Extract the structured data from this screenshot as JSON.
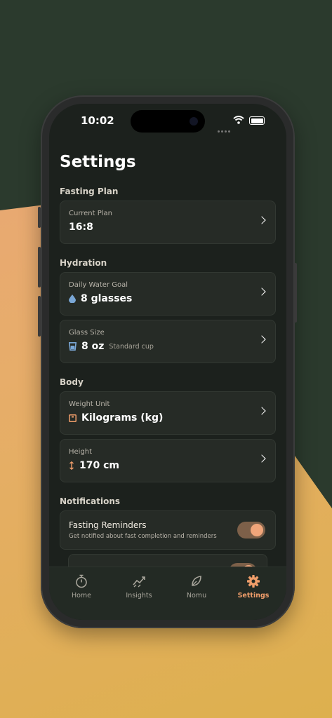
{
  "status": {
    "time": "10:02"
  },
  "page": {
    "title": "Settings"
  },
  "fasting": {
    "section": "Fasting Plan",
    "plan_label": "Current Plan",
    "plan_value": "16:8"
  },
  "hydration": {
    "section": "Hydration",
    "goal_label": "Daily Water Goal",
    "goal_value": "8 glasses",
    "glass_label": "Glass Size",
    "glass_value": "8 oz",
    "glass_sub": "Standard cup"
  },
  "body": {
    "section": "Body",
    "unit_label": "Weight Unit",
    "unit_value": "Kilograms (kg)",
    "height_label": "Height",
    "height_value": "170 cm"
  },
  "notifications": {
    "section": "Notifications",
    "reminders_label": "Fasting Reminders",
    "reminders_desc": "Get notified about fast completion and reminders",
    "reminders_on": true
  },
  "tabs": [
    {
      "label": "Home",
      "icon": "stopwatch-icon"
    },
    {
      "label": "Insights",
      "icon": "chart-icon"
    },
    {
      "label": "Nomu",
      "icon": "leaf-icon"
    },
    {
      "label": "Settings",
      "icon": "gear-icon",
      "active": true
    }
  ],
  "colors": {
    "accent": "#ef9d6a",
    "screen_bg": "#1c211d",
    "card_bg": "#262b26",
    "water_blue": "#7aa7d6"
  }
}
